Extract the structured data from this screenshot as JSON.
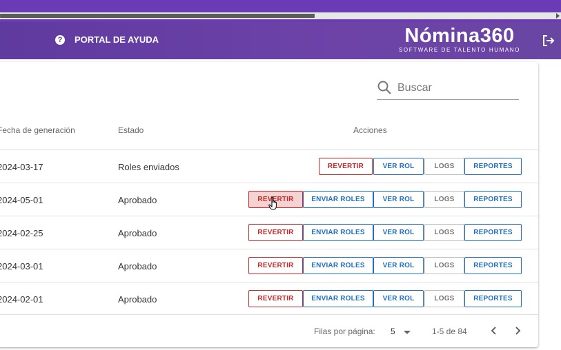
{
  "header": {
    "help_label": "PORTAL DE AYUDA",
    "logo_main": "Nómina360",
    "logo_sub": "SOFTWARE DE TALENTO HUMANO"
  },
  "search": {
    "placeholder": "Buscar"
  },
  "table": {
    "columns": {
      "date": "Fecha de generación",
      "state": "Estado",
      "actions": "Acciones"
    },
    "rows": [
      {
        "date": "2024-03-17",
        "state": "Roles enviados"
      },
      {
        "date": "2024-05-01",
        "state": "Aprobado"
      },
      {
        "date": "2024-02-25",
        "state": "Aprobado"
      },
      {
        "date": "2024-03-01",
        "state": "Aprobado"
      },
      {
        "date": "2024-02-01",
        "state": "Aprobado"
      }
    ],
    "buttons": {
      "revert": "REVERTIR",
      "send": "ENVIAR ROLES",
      "view": "VER ROL",
      "logs": "LOGS",
      "reports": "REPORTES"
    }
  },
  "pagination": {
    "rows_per_page_label": "Filas por página:",
    "rows_per_page_value": "5",
    "range": "1-5 de 84"
  },
  "colors": {
    "header_purple": "#6b3fa6",
    "danger": "#c62828",
    "primary": "#1e6fc2"
  }
}
